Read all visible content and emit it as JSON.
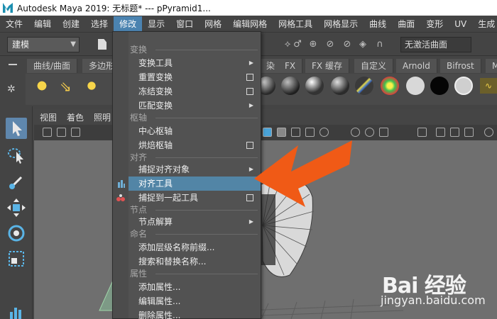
{
  "window": {
    "title": "Autodesk Maya 2019: 无标题*   ---   pPyramid1..."
  },
  "menubar": {
    "items": [
      "文件",
      "编辑",
      "创建",
      "选择",
      "修改",
      "显示",
      "窗口",
      "网格",
      "编辑网格",
      "网格工具",
      "网格显示",
      "曲线",
      "曲面",
      "变形",
      "UV",
      "生成"
    ],
    "active": "修改"
  },
  "statusline": {
    "mode": "建模",
    "live_surface": "无激活曲面"
  },
  "shelf": {
    "tabs_left": [
      "曲线/曲面",
      "多边形"
    ],
    "tabs_right": [
      "染",
      "FX",
      "FX 缓存",
      "自定义",
      "Arnold",
      "Bifrost",
      "M"
    ]
  },
  "panel_menu": [
    "视图",
    "着色",
    "照明"
  ],
  "dropdown": {
    "sections": [
      {
        "id": "transform",
        "title": "变换",
        "items": [
          {
            "label": "变换工具",
            "kind": "submenu"
          },
          {
            "label": "重置变换",
            "kind": "option"
          },
          {
            "label": "冻结变换",
            "kind": "option"
          },
          {
            "label": "匹配变换",
            "kind": "submenu"
          }
        ]
      },
      {
        "id": "pivot",
        "title": "枢轴",
        "items": [
          {
            "label": "中心枢轴",
            "kind": "plain"
          },
          {
            "label": "烘焙枢轴",
            "kind": "option"
          }
        ]
      },
      {
        "id": "align",
        "title": "对齐",
        "items": [
          {
            "label": "捕捉对齐对象",
            "kind": "submenu"
          },
          {
            "label": "对齐工具",
            "kind": "plain",
            "highlighted": true
          },
          {
            "label": "捕捉到一起工具",
            "kind": "option"
          }
        ]
      },
      {
        "id": "node",
        "title": "节点",
        "items": [
          {
            "label": "节点解算",
            "kind": "submenu"
          }
        ]
      },
      {
        "id": "naming",
        "title": "命名",
        "items": [
          {
            "label": "添加层级名称前缀...",
            "kind": "plain"
          },
          {
            "label": "搜索和替换名称...",
            "kind": "plain"
          }
        ]
      },
      {
        "id": "attributes",
        "title": "属性",
        "items": [
          {
            "label": "添加属性...",
            "kind": "plain"
          },
          {
            "label": "编辑属性...",
            "kind": "plain"
          },
          {
            "label": "删除属性...",
            "kind": "plain"
          }
        ]
      }
    ]
  },
  "annotation": {
    "arrow_color": "#f05a16"
  },
  "watermark": {
    "brand": "Bai 经验",
    "site": "jingyan.baidu.com"
  },
  "colors": {
    "highlight": "#5285a6",
    "menu_active": "#4b83b0"
  }
}
